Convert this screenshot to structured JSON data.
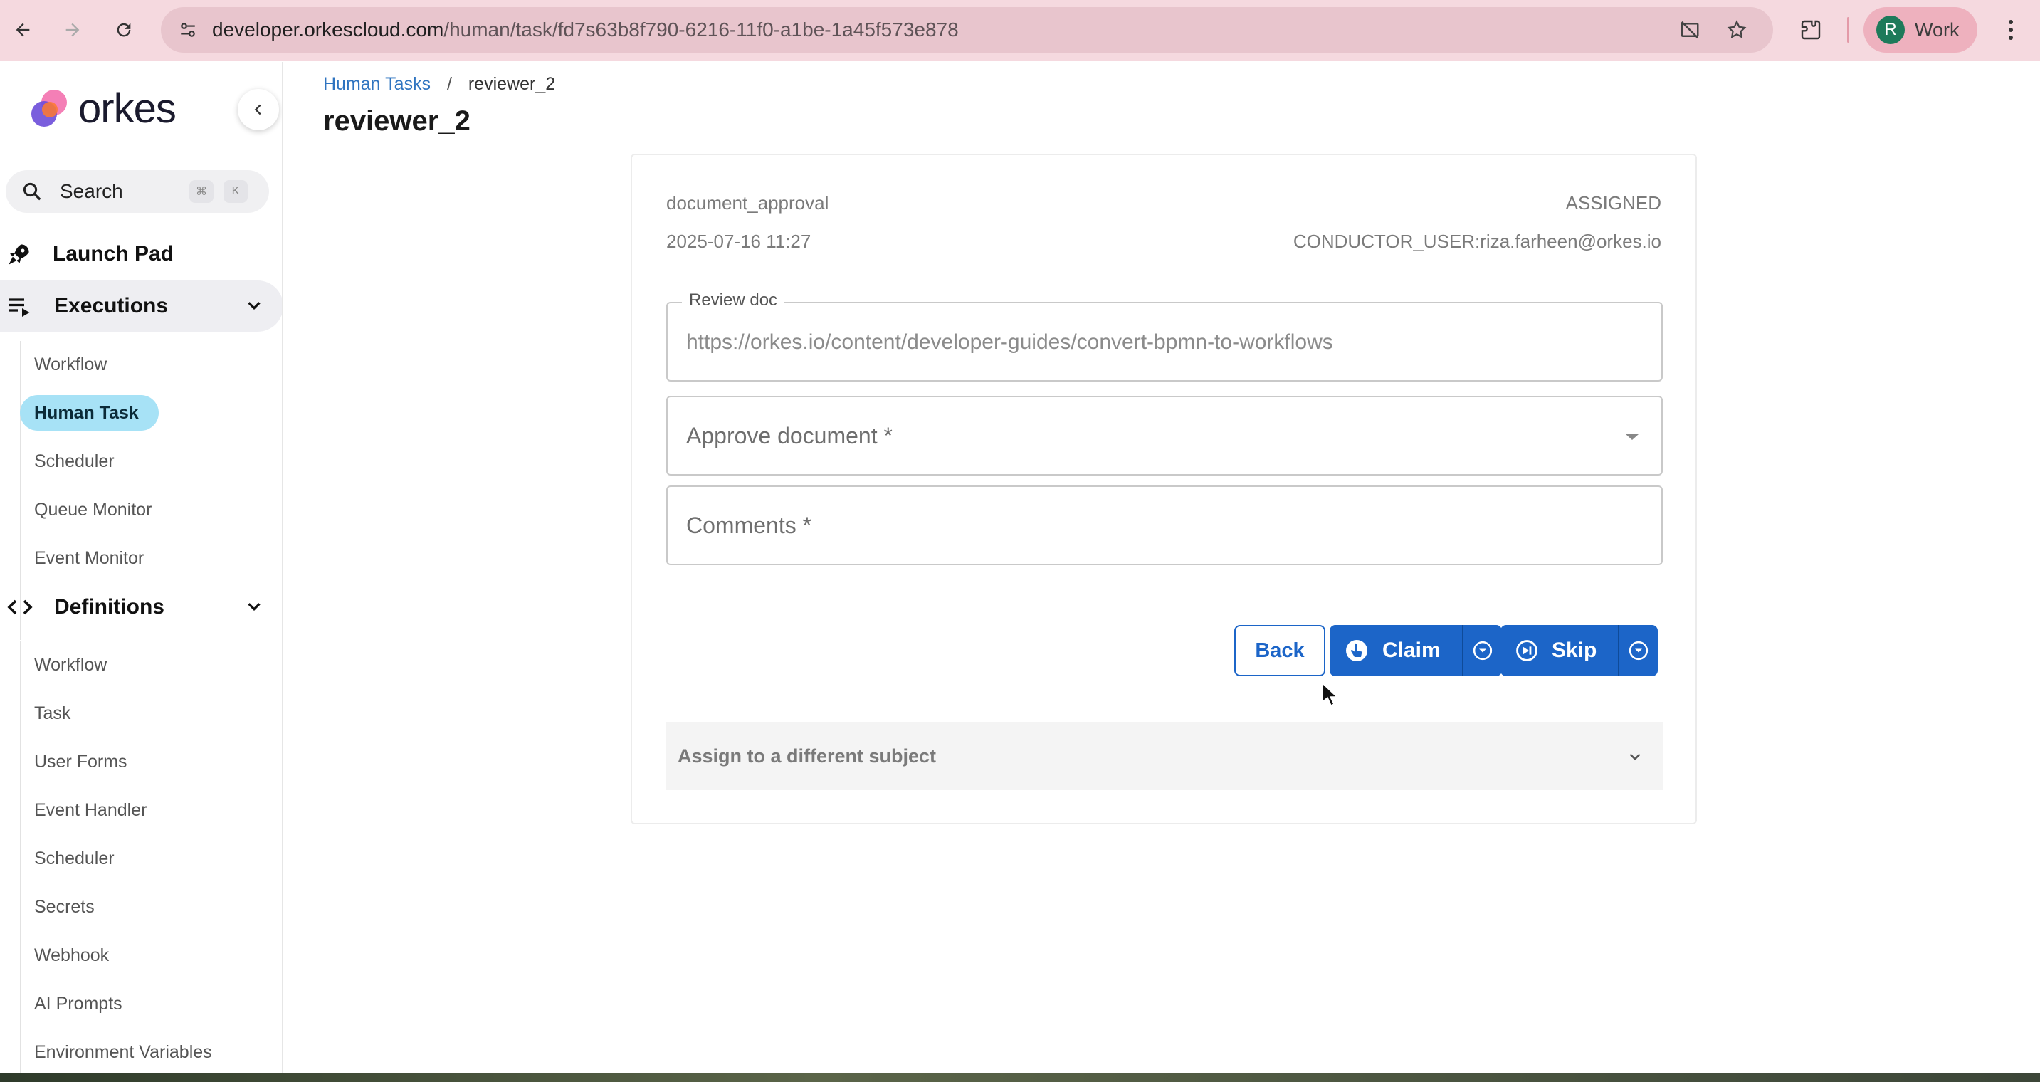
{
  "browser": {
    "url_host": "developer.orkescloud.com",
    "url_path": "/human/task/fd7s63b8f790-6216-11f0-a1be-1a45f573e878",
    "profile_initial": "R",
    "profile_name": "Work"
  },
  "sidebar": {
    "logo_text": "orkes",
    "search_label": "Search",
    "search_shortcut_1": "⌘",
    "search_shortcut_2": "K",
    "launch_pad": "Launch Pad",
    "executions": {
      "label": "Executions",
      "items": [
        "Workflow",
        "Human Task",
        "Scheduler",
        "Queue Monitor",
        "Event Monitor"
      ]
    },
    "definitions": {
      "label": "Definitions",
      "items": [
        "Workflow",
        "Task",
        "User Forms",
        "Event Handler",
        "Scheduler",
        "Secrets",
        "Webhook",
        "AI Prompts",
        "Environment Variables"
      ]
    }
  },
  "breadcrumb": {
    "parent": "Human Tasks",
    "separator": "/",
    "current": "reviewer_2"
  },
  "page_title": "reviewer_2",
  "task": {
    "name": "document_approval",
    "status": "ASSIGNED",
    "created": "2025-07-16 11:27",
    "assignee": "CONDUCTOR_USER:riza.farheen@orkes.io"
  },
  "form": {
    "review_doc_label": "Review doc",
    "review_doc_value": "https://orkes.io/content/developer-guides/convert-bpmn-to-workflows",
    "approve_placeholder": "Approve document *",
    "comments_placeholder": "Comments *"
  },
  "actions": {
    "back": "Back",
    "claim": "Claim",
    "skip": "Skip"
  },
  "accordion_label": "Assign to a different subject",
  "colors": {
    "primary": "#1c65c8",
    "selected_nav": "#a7e2f6",
    "chrome": "#f5d9df"
  }
}
